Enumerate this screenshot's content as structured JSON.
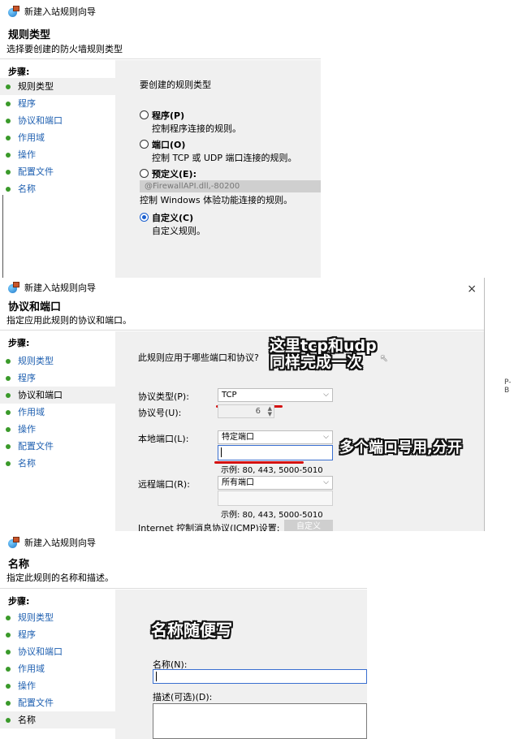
{
  "window_title": "新建入站规则向导",
  "steps_title": "步骤:",
  "steps": [
    "规则类型",
    "程序",
    "协议和端口",
    "作用域",
    "操作",
    "配置文件",
    "名称"
  ],
  "panel1": {
    "heading": "规则类型",
    "subheading": "选择要创建的防火墙规则类型",
    "question": "要创建的规则类型",
    "options": [
      {
        "label": "程序(P)",
        "desc": "控制程序连接的规则。",
        "selected": false
      },
      {
        "label": "端口(O)",
        "desc": "控制 TCP 或 UDP 端口连接的规则。",
        "selected": false
      },
      {
        "label": "预定义(E):",
        "desc": "控制 Windows 体验功能连接的规则。",
        "selected": false,
        "value": "@FirewallAPI.dll,-80200"
      },
      {
        "label": "自定义(C)",
        "desc": "自定义规则。",
        "selected": true
      }
    ]
  },
  "panel2": {
    "heading": "协议和端口",
    "subheading": "指定应用此规则的协议和端口。",
    "question": "此规则应用于哪些端口和协议?",
    "protocol_type_label": "协议类型(P):",
    "protocol_type_value": "TCP",
    "protocol_number_label": "协议号(U):",
    "protocol_number_value": "6",
    "local_port_label": "本地端口(L):",
    "local_port_value": "特定端口",
    "example1": "示例: 80, 443, 5000-5010",
    "remote_port_label": "远程端口(R):",
    "remote_port_value": "所有端口",
    "example2": "示例: 80, 443, 5000-5010",
    "icmp_label": "Internet 控制消息协议(ICMP)设置:",
    "customize_button": "自定义",
    "callout1_line1": "这里tcp和udp",
    "callout1_line2": "同样完成一次",
    "callout2": "多个端口号用,分开",
    "partial_right": "P-B",
    "close_glyph": "×"
  },
  "panel3": {
    "heading": "名称",
    "subheading": "指定此规则的名称和描述。",
    "name_label": "名称(N):",
    "desc_label": "描述(可选)(D):",
    "callout": "名称随便写"
  },
  "colors": {
    "link": "#1e5fb0",
    "step_dot": "#3a9a2a",
    "annotation_line": "#d41111"
  }
}
